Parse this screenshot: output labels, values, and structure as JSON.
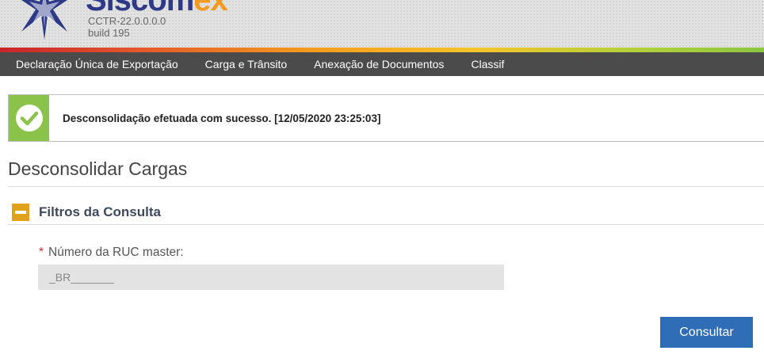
{
  "header": {
    "logo_main": "Siscom",
    "logo_accent": "ex",
    "version": "CCTR-22.0.0.0.0",
    "build": "build 195"
  },
  "nav": {
    "items": [
      {
        "label": "Declaração Única de Exportação"
      },
      {
        "label": "Carga e Trânsito"
      },
      {
        "label": "Anexação de Documentos"
      },
      {
        "label": "Classif"
      }
    ]
  },
  "alert": {
    "message": "Desconsolidação efetuada com sucesso. [12/05/2020 23:25:03]",
    "color": "#8bc34a"
  },
  "page": {
    "title": "Desconsolidar Cargas"
  },
  "filters": {
    "label": "Filtros da Consulta"
  },
  "form": {
    "required_mark": "*",
    "ruc_label": "Número da RUC master:",
    "ruc_value": "_BR_______"
  },
  "actions": {
    "consultar_label": "Consultar"
  },
  "colors": {
    "nav_bg": "#4b4b4b",
    "button": "#2f6db6",
    "collapse_icon": "#e0a21a",
    "logo_blue": "#2e3a87",
    "logo_orange": "#f39a1e"
  }
}
